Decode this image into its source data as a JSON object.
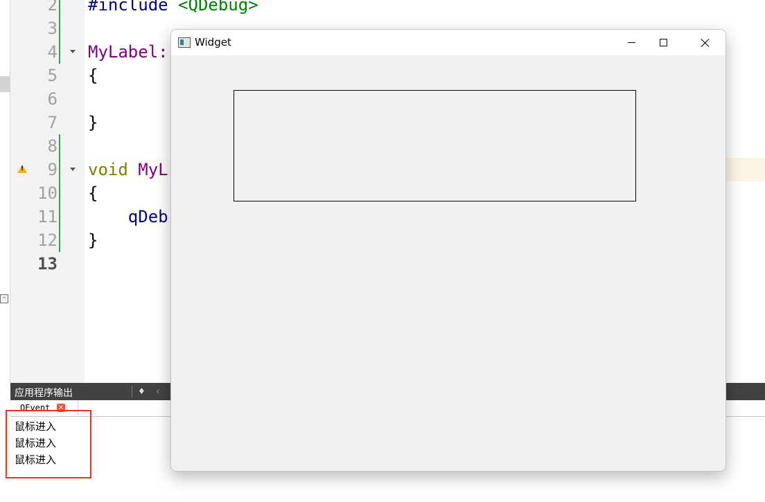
{
  "editor": {
    "lines": [
      {
        "number": "2",
        "tokens": [
          {
            "text": "#include ",
            "cls": "kw-pre"
          },
          {
            "text": "<QDebug>",
            "cls": "kw-inc"
          }
        ]
      },
      {
        "number": "3",
        "tokens": []
      },
      {
        "number": "4",
        "tokens": [
          {
            "text": "MyLabel:",
            "cls": "kw-cls"
          }
        ]
      },
      {
        "number": "5",
        "tokens": [
          {
            "text": "{",
            "cls": ""
          }
        ]
      },
      {
        "number": "6",
        "tokens": []
      },
      {
        "number": "7",
        "tokens": [
          {
            "text": "}",
            "cls": ""
          }
        ]
      },
      {
        "number": "8",
        "tokens": []
      },
      {
        "number": "9",
        "tokens": [
          {
            "text": "void ",
            "cls": "kw-type"
          },
          {
            "text": "MyL",
            "cls": "kw-cls"
          }
        ]
      },
      {
        "number": "10",
        "tokens": [
          {
            "text": "{",
            "cls": ""
          }
        ]
      },
      {
        "number": "11",
        "tokens": [
          {
            "text": "    ",
            "cls": ""
          },
          {
            "text": "qDeb",
            "cls": "kw-pre"
          }
        ]
      },
      {
        "number": "12",
        "tokens": [
          {
            "text": "}",
            "cls": ""
          }
        ]
      },
      {
        "number": "13",
        "tokens": []
      }
    ],
    "current_line": "13",
    "warning_line": "9",
    "fold_lines": [
      "4",
      "9"
    ],
    "changed_lines": [
      "2",
      "3",
      "4",
      "8",
      "9",
      "10",
      "11",
      "12"
    ]
  },
  "output": {
    "title": "应用程序输出",
    "tab_label": "QEvent",
    "lines": [
      "鼠标进入",
      "鼠标进入",
      "鼠标进入"
    ]
  },
  "window": {
    "title": "Widget"
  },
  "colors": {
    "highlight_box": "#e8331c",
    "warning": "#f2b600",
    "change_bar": "#31a354"
  },
  "icons": {
    "output_clear": "broom-icon",
    "output_prev": "chevron-left-icon",
    "window": "app-icon",
    "minimize": "minimize-icon",
    "maximize": "maximize-icon",
    "close": "close-icon"
  }
}
